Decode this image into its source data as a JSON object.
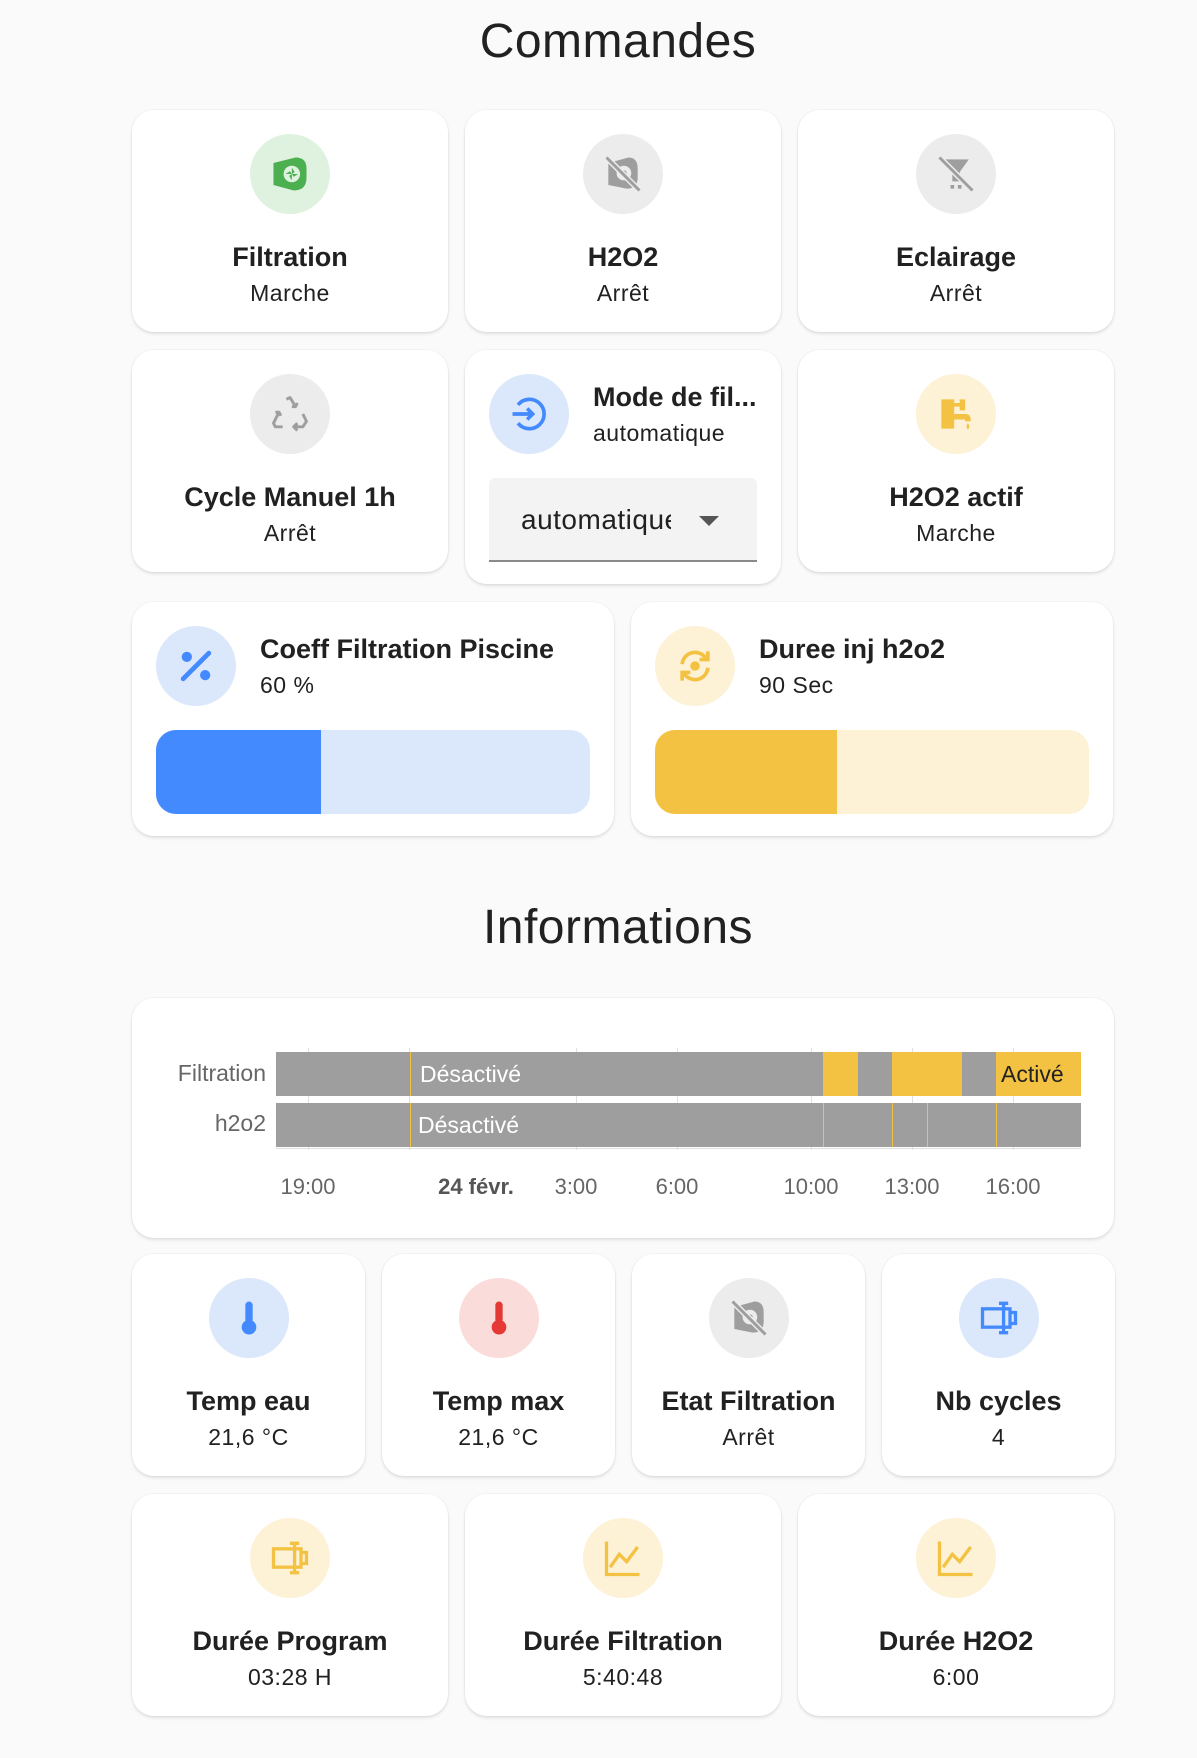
{
  "colors": {
    "green": "#4caf50",
    "green_bg": "#dff2e0",
    "grey": "#9e9e9e",
    "grey_bg": "#ececec",
    "blue": "#448aff",
    "blue_bg": "#dbe8fb",
    "amber": "#f4c242",
    "amber_bg": "#fdf1d6",
    "red": "#e53935",
    "red_bg": "#fadcda"
  },
  "commands": {
    "title": "Commandes",
    "filtration": {
      "name": "Filtration",
      "state": "Marche",
      "icon": "pump-icon"
    },
    "h2o2": {
      "name": "H2O2",
      "state": "Arrêt",
      "icon": "pump-off-icon"
    },
    "eclairage": {
      "name": "Eclairage",
      "state": "Arrêt",
      "icon": "light-off-icon"
    },
    "cycle": {
      "name": "Cycle Manuel 1h",
      "state": "Arrêt",
      "icon": "recycle-icon"
    },
    "mode": {
      "name": "Mode de fil...",
      "state": "automatique",
      "selected": "automatique",
      "icon": "arrow-circle-icon"
    },
    "h2o2_actif": {
      "name": "H2O2 actif",
      "state": "Marche",
      "icon": "faucet-icon"
    },
    "coeff": {
      "name": "Coeff Filtration Piscine",
      "state": "60 %",
      "level": 0.38,
      "icon": "percent-icon"
    },
    "duree_inj": {
      "name": "Duree inj h2o2",
      "state": "90 Sec",
      "level": 0.42,
      "icon": "sync-icon"
    }
  },
  "informations": {
    "title": "Informations",
    "timeline": {
      "rows": [
        {
          "label": "Filtration",
          "text_off": "Désactivé",
          "text_on": "Activé"
        },
        {
          "label": "h2o2",
          "text_off": "Désactivé"
        }
      ],
      "ticks": [
        "19:00",
        "24 févr.",
        "3:00",
        "6:00",
        "10:00",
        "13:00",
        "16:00"
      ]
    },
    "temp_eau": {
      "name": "Temp eau",
      "state": "21,6 °C",
      "icon": "thermometer-icon"
    },
    "temp_max": {
      "name": "Temp max",
      "state": "21,6 °C",
      "icon": "thermometer-icon"
    },
    "etat_filtration": {
      "name": "Etat Filtration",
      "state": "Arrêt",
      "icon": "pump-off-icon"
    },
    "nb_cycles": {
      "name": "Nb cycles",
      "state": "4",
      "icon": "counter-icon"
    },
    "duree_program": {
      "name": "Durée Program",
      "state": "03:28 H",
      "icon": "counter-icon"
    },
    "duree_filtration": {
      "name": "Durée Filtration",
      "state": "5:40:48",
      "icon": "chart-line-icon"
    },
    "duree_h2o2": {
      "name": "Durée H2O2",
      "state": "6:00",
      "icon": "chart-line-icon"
    }
  }
}
